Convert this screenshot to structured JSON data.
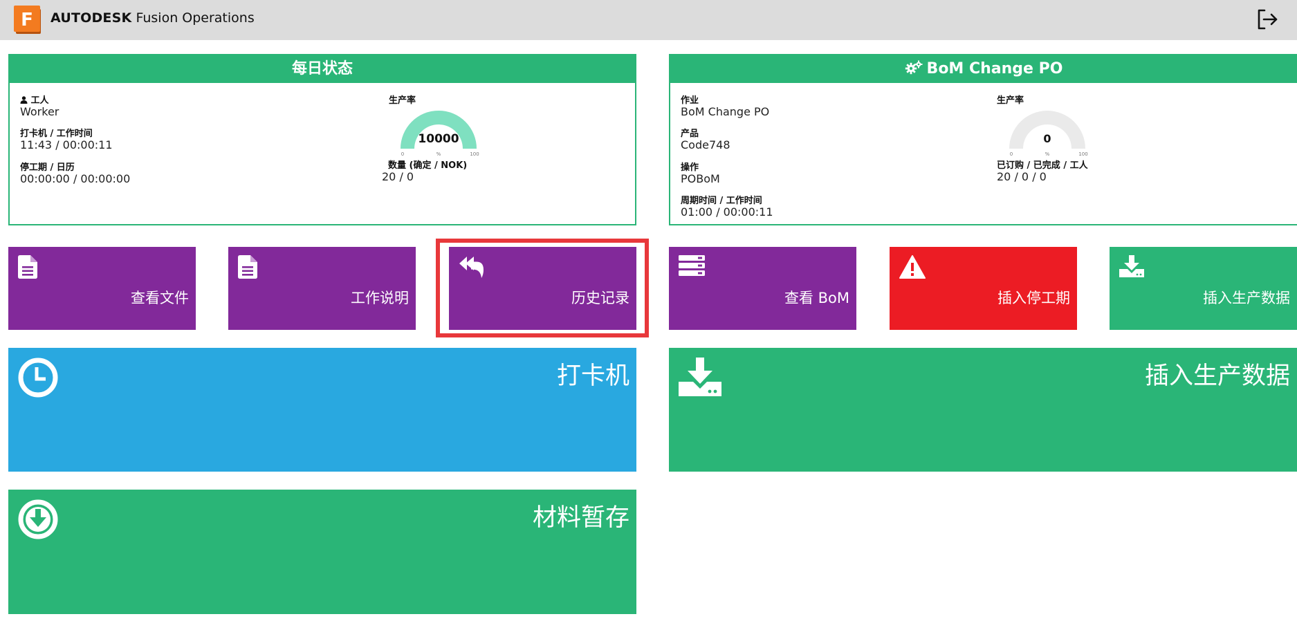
{
  "header": {
    "brand_bold": "AUTODESK",
    "brand_rest": " Fusion Operations",
    "logo_letter": "F",
    "logo_color": "#f37b20",
    "logout_icon": "logout-icon"
  },
  "daily_status": {
    "title": "每日状态",
    "worker_label": "工人",
    "worker_value": "Worker",
    "clock_label": "打卡机 / 工作时间",
    "clock_value": "11:43 / 00:00:11",
    "downtime_label": "停工期 / 日历",
    "downtime_value": "00:00:00 / 00:00:00",
    "productivity_label": "生产率",
    "productivity_value": "10000",
    "productivity_percent": 100,
    "gauge_min": "0",
    "gauge_unit": "%",
    "gauge_max": "100",
    "quantity_label": "数量 (确定 / NOK)",
    "quantity_value": "20 / 0"
  },
  "bom_panel": {
    "title": "BoM Change PO",
    "job_label": "作业",
    "job_value": "BoM Change PO",
    "product_label": "产品",
    "product_value": "Code748",
    "operation_label": "操作",
    "operation_value": "POBoM",
    "cycle_label": "周期时间 / 工作时间",
    "cycle_value": "01:00 / 00:00:11",
    "productivity_label": "生产率",
    "productivity_value": "0",
    "productivity_percent": 0,
    "gauge_min": "0",
    "gauge_unit": "%",
    "gauge_max": "100",
    "ordered_label": "已订购 / 已完成 / 工人",
    "ordered_value": "20 / 0 / 0"
  },
  "tiles": {
    "view_files": "查看文件",
    "work_instructions": "工作说明",
    "history": "历史记录",
    "view_bom": "查看 BoM",
    "insert_downtime": "插入停工期",
    "insert_production_small": "插入生产数据",
    "time_clock": "打卡机",
    "insert_production_large": "插入生产数据",
    "material_staging": "材料暂存"
  },
  "colors": {
    "green": "#2ab577",
    "purple": "#82299a",
    "red": "#ec1c24",
    "blue": "#29a8e0",
    "gauge_fill": "#7fe0c0",
    "gauge_empty": "#eaeaea",
    "highlight": "#e8383b"
  }
}
